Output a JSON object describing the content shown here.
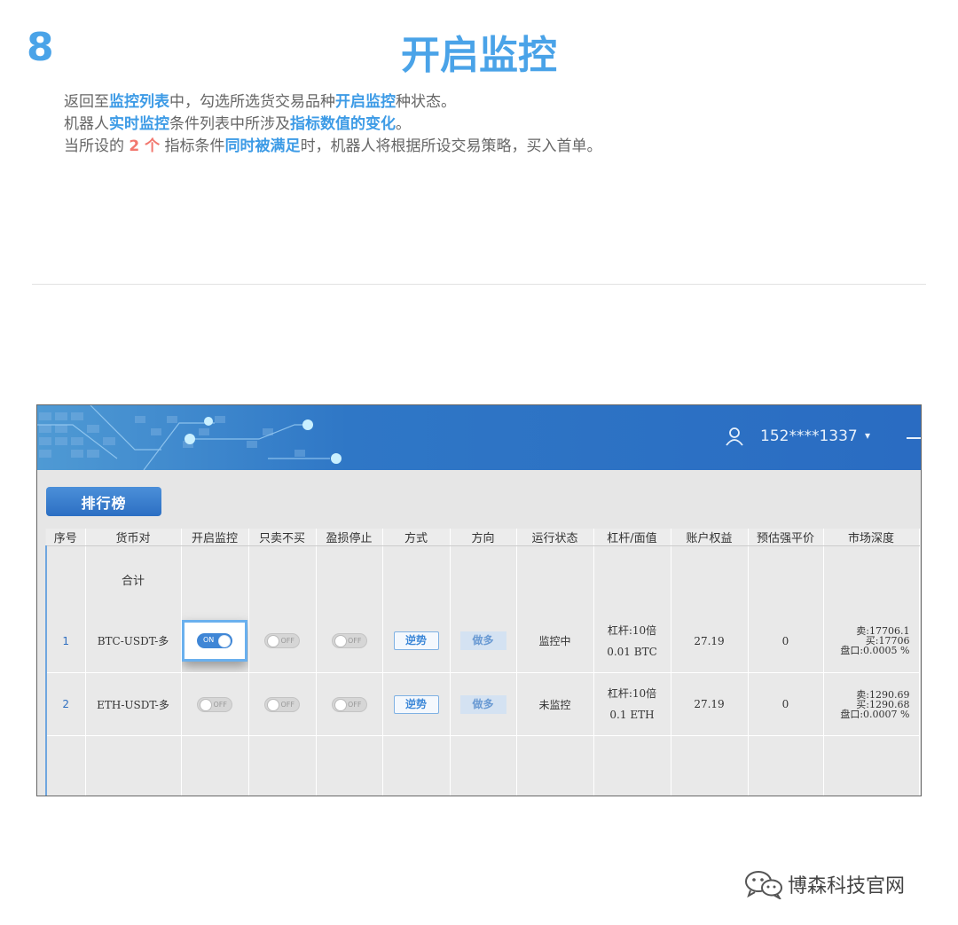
{
  "step": {
    "number": "8",
    "title": "开启监控"
  },
  "description": {
    "line1": {
      "p1": "返回至",
      "h1": "监控列表",
      "p2": "中，勾选所选货交易品种",
      "h2": "开启监控",
      "p3": "种状态。"
    },
    "line2": {
      "p1": "机器人",
      "h1": "实时监控",
      "p2": "条件列表中所涉及",
      "h2": "指标数值的变化",
      "p3": "。"
    },
    "line3": {
      "p1": "当所设的 ",
      "count": "2 个",
      "p2": " 指标条件",
      "h1": "同时被满足",
      "p3": "时，机器人将根据所设交易策略，买入首单。"
    }
  },
  "app": {
    "user": {
      "phone": "152****1337",
      "caret": "▾",
      "minimize": "—"
    },
    "rank_button": "排行榜",
    "columns": [
      "序号",
      "货币对",
      "开启监控",
      "只卖不买",
      "盈损停止",
      "方式",
      "方向",
      "运行状态",
      "杠杆/面值",
      "账户权益",
      "预估强平价",
      "市场深度"
    ],
    "total_label": "合计",
    "rows": [
      {
        "index": "1",
        "pair": "BTC-USDT-多",
        "monitor": {
          "state": "on",
          "label": "ON"
        },
        "sell_only": {
          "state": "off",
          "label": "OFF"
        },
        "stop_loss": {
          "state": "off",
          "label": "OFF"
        },
        "mode": "逆势",
        "direction": "做多",
        "status": "监控中",
        "leverage": "杠杆:10倍",
        "face_value": "0.01 BTC",
        "equity": "27.19",
        "liq_price": "0",
        "depth": {
          "sell": "卖:17706.1",
          "buy": "买:17706",
          "spread": "盘口:0.0005 %"
        }
      },
      {
        "index": "2",
        "pair": "ETH-USDT-多",
        "monitor": {
          "state": "off",
          "label": "OFF"
        },
        "sell_only": {
          "state": "off",
          "label": "OFF"
        },
        "stop_loss": {
          "state": "off",
          "label": "OFF"
        },
        "mode": "逆势",
        "direction": "做多",
        "status": "未监控",
        "leverage": "杠杆:10倍",
        "face_value": "0.1 ETH",
        "equity": "27.19",
        "liq_price": "0",
        "depth": {
          "sell": "卖:1290.69",
          "buy": "买:1290.68",
          "spread": "盘口:0.0007 %"
        }
      }
    ]
  },
  "footer": {
    "brand": "博森科技官网"
  },
  "colors": {
    "accent": "#4aa3e8",
    "highlight_red": "#f2776e",
    "header_blue": "#2a6cc2"
  }
}
